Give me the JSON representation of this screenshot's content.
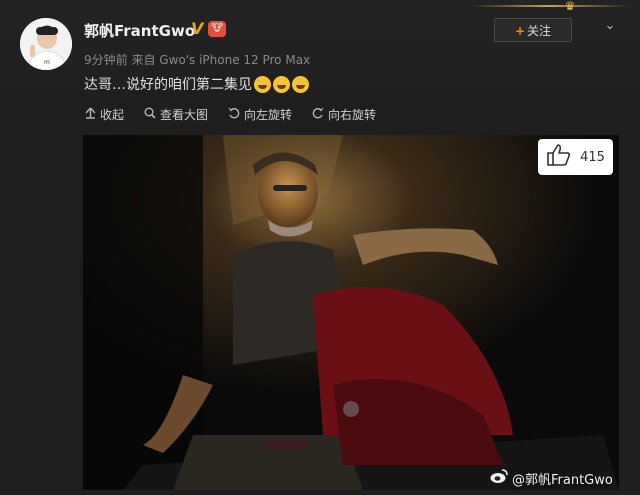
{
  "header": {
    "username": "郭帆FrantGwo",
    "verified_mark": "V",
    "badge_text": "🐮",
    "meta": "9分钟前 来自 Gwo's iPhone 12 Pro Max",
    "follow_label": "关注",
    "follow_plus": "+",
    "chevron": "⌄",
    "crown": "♛"
  },
  "post": {
    "text": "达哥…说好的咱们第二集见"
  },
  "toolbar": {
    "collapse": "收起",
    "view_large": "查看大图",
    "rotate_left": "向左旋转",
    "rotate_right": "向右旋转"
  },
  "image": {
    "likes": "415",
    "watermark": "@郭帆FrantGwo"
  },
  "icons": {
    "collapse": "collapse-icon",
    "search": "search-icon",
    "rotate_left": "rotate-left-icon",
    "rotate_right": "rotate-right-icon",
    "thumb": "thumbs-up-icon",
    "weibo": "weibo-logo-icon"
  },
  "colors": {
    "background": "#1e1e1e",
    "accent": "#ff8200",
    "verified": "#f2a90c"
  }
}
